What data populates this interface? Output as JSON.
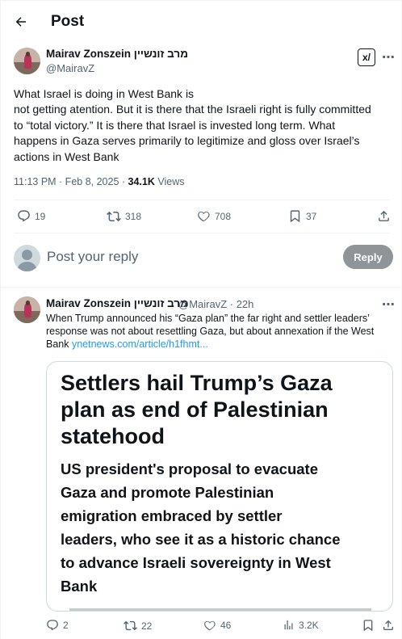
{
  "header": {
    "title": "Post"
  },
  "main_post": {
    "author_name": "Mairav Zonszein מרב זונשיין",
    "author_handle": "@MairavZ",
    "grok_label": "x/",
    "text_lines": [
      "What Israel is doing in West Bank is",
      "not getting atention. But it is there that the Israeli right is fully committed",
      "to “total victory.” It is there that Israel is invested long term. What",
      "happens in Gaza serves primarily to legitimize and gloss over Israel’s",
      "actions in West Bank"
    ],
    "timestamp": "11:13 PM · Feb 8, 2025 · ",
    "views_count": "34.1K",
    "views_label": " Views",
    "replies": "19",
    "reposts": "318",
    "likes": "708",
    "bookmarks": "37"
  },
  "reply_box": {
    "placeholder": "Post your reply",
    "button": "Reply"
  },
  "reply_post": {
    "author_name": "Mairav Zonszein מרב זונשיין",
    "author_handle": "@MairavZ · 22h",
    "text_lines": [
      "When Trump announced his “Gaza plan” the far right and settler leaders’",
      "response was not about resettling Gaza, but about annexation if the West"
    ],
    "text_last": "Bank ",
    "link": "ynetnews.com/article/h1fhmt...",
    "card": {
      "title_lines": [
        "Settlers hail Trump’s Gaza",
        "plan as end of Palestinian",
        "statehood"
      ],
      "subtitle_lines": [
        "US president's proposal to evacuate",
        "Gaza and promote Palestinian",
        "emigration embraced by settler",
        "leaders, who see it as a historic chance",
        "to advance Israeli sovereignty in West",
        "Bank"
      ]
    },
    "replies": "2",
    "reposts": "22",
    "likes": "46",
    "views": "3.2K"
  },
  "icons": [
    "back-arrow-icon",
    "grok-icon",
    "more-icon",
    "reply-icon",
    "repost-icon",
    "like-icon",
    "bookmark-icon",
    "share-icon",
    "views-icon"
  ]
}
